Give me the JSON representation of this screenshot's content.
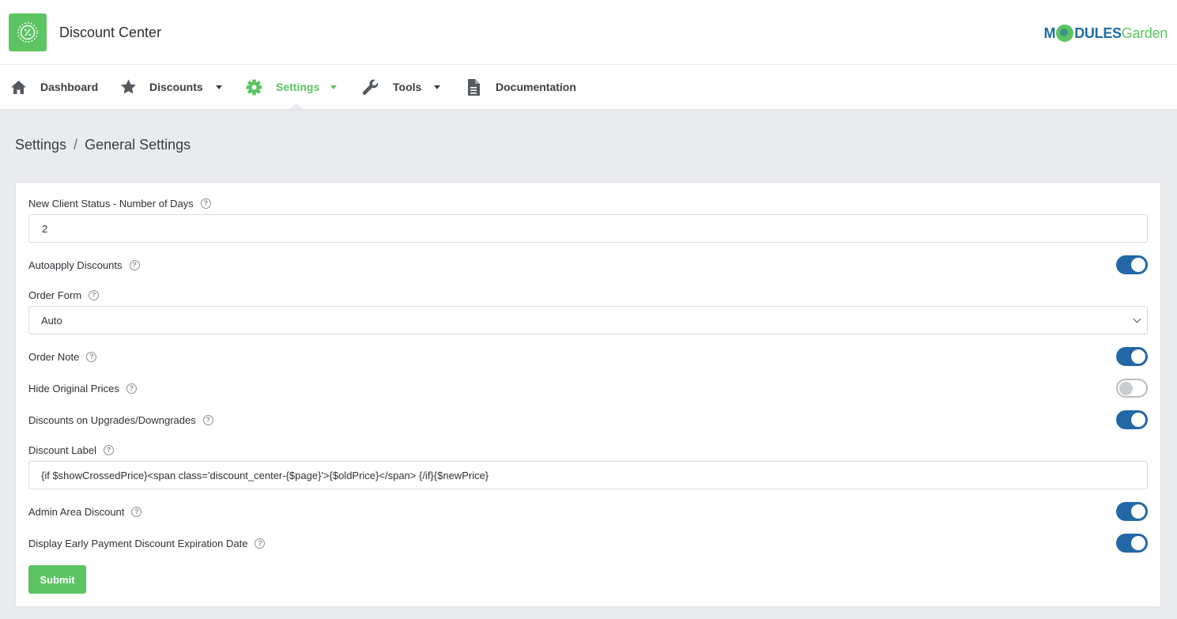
{
  "app": {
    "title": "Discount Center",
    "brand_part1": "M",
    "brand_part2": "DULES",
    "brand_part3": "Garden"
  },
  "nav": {
    "items": [
      {
        "label": "Dashboard",
        "icon": "home-icon"
      },
      {
        "label": "Discounts",
        "icon": "star-icon",
        "dropdown": true
      },
      {
        "label": "Settings",
        "icon": "gear-icon",
        "dropdown": true,
        "active": true
      },
      {
        "label": "Tools",
        "icon": "wrench-icon",
        "dropdown": true
      },
      {
        "label": "Documentation",
        "icon": "document-icon"
      }
    ]
  },
  "breadcrumb": {
    "parent": "Settings",
    "separator": "/",
    "current": "General Settings"
  },
  "form": {
    "new_client_days": {
      "label": "New Client Status - Number of Days",
      "value": "2"
    },
    "autoapply": {
      "label": "Autoapply Discounts",
      "enabled": true
    },
    "order_form": {
      "label": "Order Form",
      "value": "Auto"
    },
    "order_note": {
      "label": "Order Note",
      "enabled": true
    },
    "hide_prices": {
      "label": "Hide Original Prices",
      "enabled": false
    },
    "upgrades": {
      "label": "Discounts on Upgrades/Downgrades",
      "enabled": true
    },
    "discount_label": {
      "label": "Discount Label",
      "value": "{if $showCrossedPrice}<span class='discount_center-{$page}'>{$oldPrice}</span> {/if}{$newPrice}"
    },
    "admin_area": {
      "label": "Admin Area Discount",
      "enabled": true
    },
    "early_payment": {
      "label": "Display Early Payment Discount Expiration Date",
      "enabled": true
    },
    "submit_label": "Submit"
  },
  "colors": {
    "accent_green": "#5cc461",
    "toggle_blue": "#2467a6",
    "brand_blue": "#1f6da8"
  }
}
